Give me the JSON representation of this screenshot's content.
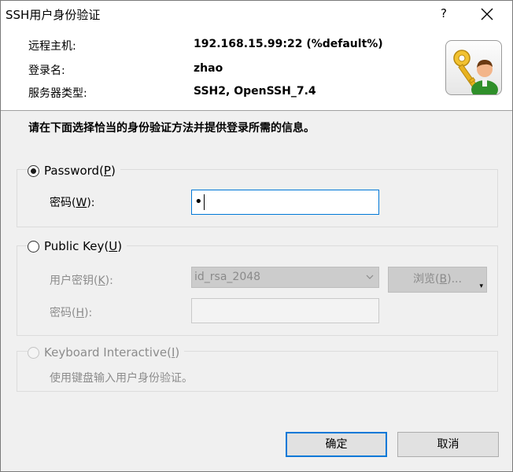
{
  "window": {
    "title": "SSH用户身份验证",
    "help_label": "?"
  },
  "info": {
    "host_label": "远程主机:",
    "host_value": "192.168.15.99:22 (%default%)",
    "user_label": "登录名:",
    "user_value": "zhao",
    "server_label": "服务器类型:",
    "server_value": "SSH2, OpenSSH_7.4"
  },
  "instruction": "请在下面选择恰当的身份验证方法并提供登录所需的信息。",
  "password_method": {
    "label": "Password(",
    "accel": "P",
    "label_end": ")",
    "checked": true,
    "field_label": "密码(",
    "field_accel": "W",
    "field_label_end": "):",
    "value": "•"
  },
  "publickey_method": {
    "label": "Public Key(",
    "accel": "U",
    "label_end": ")",
    "key_label": "用户密钥(",
    "key_accel": "K",
    "key_label_end": "):",
    "key_value": "id_rsa_2048",
    "browse_label": "浏览(",
    "browse_accel": "B",
    "browse_label_end": ")...",
    "pass_label": "密码(",
    "pass_accel": "H",
    "pass_label_end": "):"
  },
  "keyboard_method": {
    "label": "Keyboard Interactive(",
    "accel": "I",
    "label_end": ")",
    "hint": "使用键盘输入用户身份验证。"
  },
  "buttons": {
    "ok": "确定",
    "cancel": "取消"
  },
  "icons": {
    "avatar": "user-key-icon",
    "close": "close-icon",
    "dropdown": "chevron-down-icon"
  },
  "colors": {
    "accent": "#0078d7",
    "background": "#f0f0f0"
  }
}
